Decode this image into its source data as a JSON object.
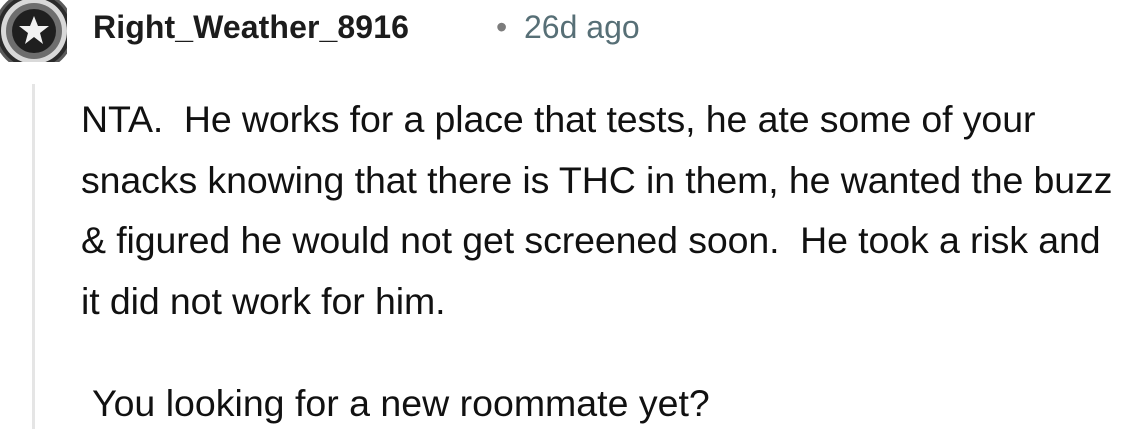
{
  "comment": {
    "author": "Right_Weather_8916",
    "separator": "•",
    "age": "26d ago",
    "avatar_icon": "star-shield-avatar-icon",
    "paragraphs": [
      "NTA.  He works for a place that tests, he ate some of your snacks knowing that there is THC in them, he wanted the buzz & figured he would not get screened soon.  He took a risk and it did not work for him.",
      "You looking for a new roommate yet?"
    ]
  },
  "colors": {
    "username": "#1c1c1c",
    "timestamp": "#576f76",
    "body_text": "#111111",
    "thread_line": "#e5e5e5",
    "avatar_ring": "#3a3a3a"
  }
}
